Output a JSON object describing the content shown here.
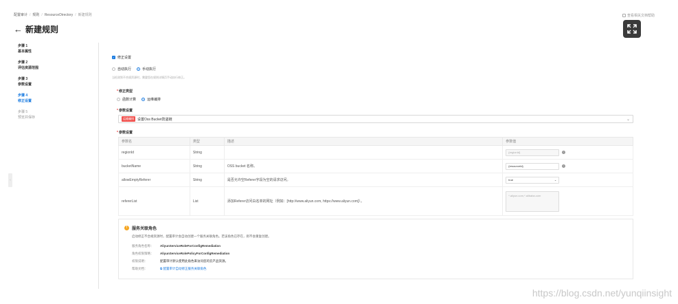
{
  "breadcrumb": [
    "配置审计",
    "规则",
    "ResourceDirectory",
    "新建规则"
  ],
  "help_link": "查看相关文档帮助",
  "page": {
    "title": "新建规则",
    "back_icon": "arrow-left-icon"
  },
  "steps": [
    {
      "num": "步骤 1",
      "name": "基本属性",
      "state": "done"
    },
    {
      "num": "步骤 2",
      "name": "评估资源范围",
      "state": "done"
    },
    {
      "num": "步骤 3",
      "name": "参数设置",
      "state": "done"
    },
    {
      "num": "步骤 4",
      "name": "修正设置",
      "state": "active"
    },
    {
      "num": "步骤 5",
      "name": "预览并保存",
      "state": "inactive"
    }
  ],
  "remediation": {
    "enable_label": "修正设置",
    "exec_options": [
      "自动执行",
      "手动执行"
    ],
    "exec_selected": "手动执行",
    "exec_hint": "当检测到不合规资源时，需要您在规则详情页手动执行修正。",
    "type_label": "修正类型",
    "type_options": [
      "函数计算",
      "运维编排"
    ],
    "type_selected": "运维编排",
    "template_label": "参数设置",
    "template_tag": "运维编排",
    "template_value": "设置Oss Bucket防盗链",
    "params_label": "参数设置"
  },
  "param_table": {
    "headers": [
      "参数名",
      "类型",
      "描述",
      "参数值"
    ],
    "rows": [
      {
        "name": "regionId",
        "type": "String",
        "desc": "",
        "value": "{regionId}",
        "kind": "disabled"
      },
      {
        "name": "bucketName",
        "type": "String",
        "desc": "OSS bucket 名称。",
        "value": "{resourceId}",
        "kind": "filled"
      },
      {
        "name": "allowEmptyReferer",
        "type": "String",
        "desc": "是否允许空Referer字段为空的请求访问。",
        "value": "true",
        "kind": "select"
      },
      {
        "name": "refererList",
        "type": "List",
        "desc": "添加Referer访问白名单的网址（例如：[http://www.aliyun.com, https://www.aliyun.com]）。",
        "value": "*.aliyun.com,*.alibaba.com",
        "kind": "textarea"
      }
    ]
  },
  "service_role": {
    "title": "服务关联角色",
    "desc": "启动修正不合规资源时，配置审计会自动创建一个服务关联角色。若该角色已存在，则不会重复创建。",
    "lines": [
      {
        "k": "服务角色名称：",
        "v": "AliyunServiceRoleForConfigRemediation",
        "style": "bold"
      },
      {
        "k": "角色权限策略：",
        "v": "AliyunServiceRolePolicyForConfigRemediation",
        "style": "bold"
      },
      {
        "k": "权限说明：",
        "v": "配置审计默认使用此角色来访问您的云产品资源。",
        "style": "plain"
      },
      {
        "k": "帮助文档：",
        "v": "配置审计自动修正服务关联角色",
        "style": "link"
      }
    ]
  },
  "watermark": "https://blog.csdn.net/yunqiinsight"
}
